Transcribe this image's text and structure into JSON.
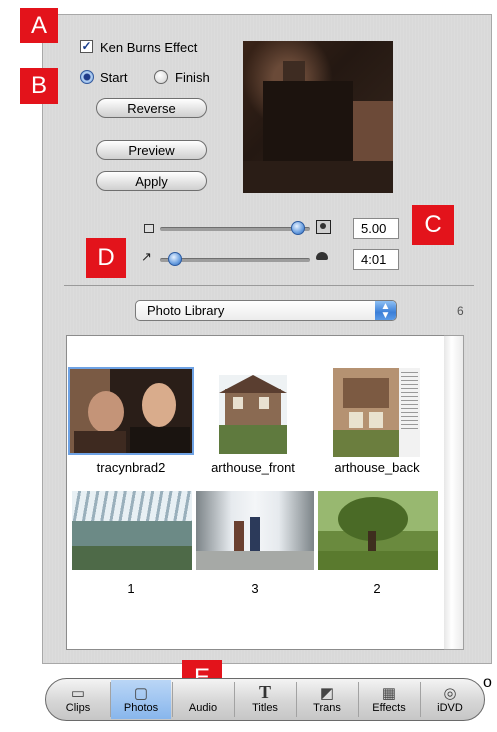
{
  "markers": [
    "A",
    "B",
    "C",
    "D",
    "E"
  ],
  "ken_burns": {
    "label": "Ken Burns Effect",
    "checked": true
  },
  "direction": {
    "start_label": "Start",
    "finish_label": "Finish",
    "selected": "Start"
  },
  "buttons": {
    "reverse": "Reverse",
    "preview": "Preview",
    "apply": "Apply"
  },
  "zoom": {
    "value": "5.00",
    "level": 0.92
  },
  "duration": {
    "value": "4:01",
    "level": 0.1
  },
  "library": {
    "selected": "Photo Library",
    "count": "6"
  },
  "photos": [
    {
      "caption": "tracynbrad2",
      "selected": true
    },
    {
      "caption": "arthouse_front",
      "selected": false
    },
    {
      "caption": "arthouse_back",
      "selected": false
    },
    {
      "caption": "1",
      "selected": false
    },
    {
      "caption": "3",
      "selected": false
    },
    {
      "caption": "2",
      "selected": false
    }
  ],
  "toolbar": [
    {
      "label": "Clips",
      "icon": "clips-icon",
      "glyph": "▭"
    },
    {
      "label": "Photos",
      "icon": "photos-icon",
      "glyph": "▢"
    },
    {
      "label": "Audio",
      "icon": "audio-icon",
      "glyph": "♪"
    },
    {
      "label": "Titles",
      "icon": "titles-icon",
      "glyph": "T"
    },
    {
      "label": "Trans",
      "icon": "transitions-icon",
      "glyph": "◩"
    },
    {
      "label": "Effects",
      "icon": "effects-icon",
      "glyph": "▦"
    },
    {
      "label": "iDVD",
      "icon": "idvd-icon",
      "glyph": "◎"
    }
  ],
  "colors": {
    "accent": "#e3131b",
    "selection": "#88b6ec"
  },
  "outside_text": "o"
}
